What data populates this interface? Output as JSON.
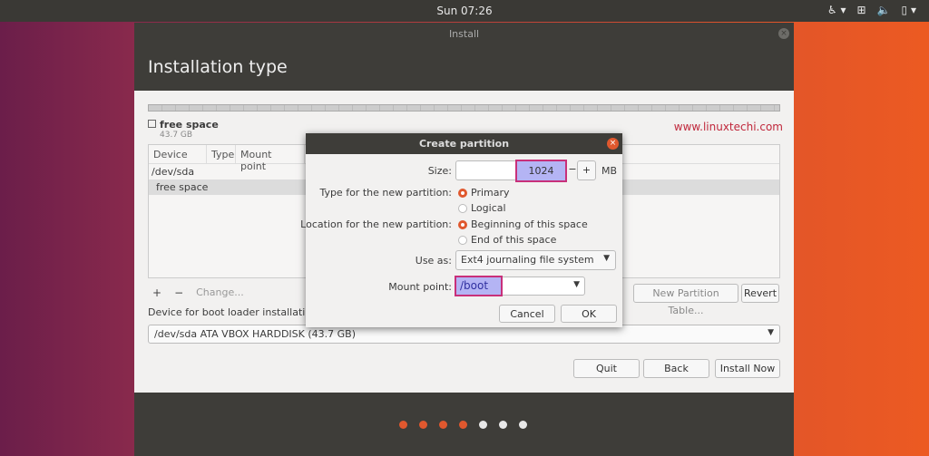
{
  "topbar": {
    "clock": "Sun 07:26",
    "icons": [
      "accessibility-icon",
      "network-icon",
      "volume-icon",
      "battery-icon"
    ]
  },
  "window": {
    "title": "Install",
    "heading": "Installation type"
  },
  "partition_bar": {
    "free_label": "free space",
    "free_size": "43.7 GB"
  },
  "watermark": "www.linuxtechi.com",
  "table": {
    "headers": [
      "Device",
      "Type",
      "Mount point"
    ],
    "rows": [
      "/dev/sda",
      "free space"
    ]
  },
  "tools": {
    "add": "+",
    "remove": "−",
    "change": "Change...",
    "new_table": "New Partition Table...",
    "revert": "Revert"
  },
  "boot": {
    "label": "Device for boot loader installation:",
    "value": "/dev/sda ATA VBOX HARDDISK (43.7 GB)"
  },
  "buttons": {
    "quit": "Quit",
    "back": "Back",
    "install": "Install Now"
  },
  "progress": {
    "total_steps": 7,
    "completed_steps": 4,
    "active_color": "#e0582e",
    "inactive_color": "#e8e8e8"
  },
  "dialog": {
    "title": "Create partition",
    "size_label": "Size:",
    "size_value": "1024",
    "size_unit": "MB",
    "minus": "−",
    "plus": "+",
    "type_label": "Type for the new partition:",
    "type_options": [
      "Primary",
      "Logical"
    ],
    "type_selected": "Primary",
    "location_label": "Location for the new partition:",
    "location_options": [
      "Beginning of this space",
      "End of this space"
    ],
    "location_selected": "Beginning of this space",
    "use_as_label": "Use as:",
    "use_as_value": "Ext4 journaling file system",
    "mount_label": "Mount point:",
    "mount_value": "/boot",
    "cancel": "Cancel",
    "ok": "OK"
  }
}
